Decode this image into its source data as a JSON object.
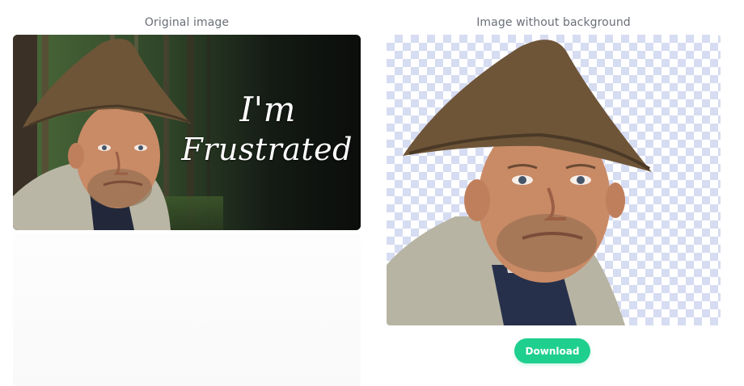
{
  "original": {
    "title": "Original image",
    "overlay_line1": "I'm",
    "overlay_line2": "Frustrated"
  },
  "result": {
    "title": "Image without background"
  },
  "actions": {
    "download_label": "Download"
  },
  "colors": {
    "accent": "#1fcf8e",
    "checker": "#d6dcf1",
    "title_text": "#6a6f77"
  }
}
